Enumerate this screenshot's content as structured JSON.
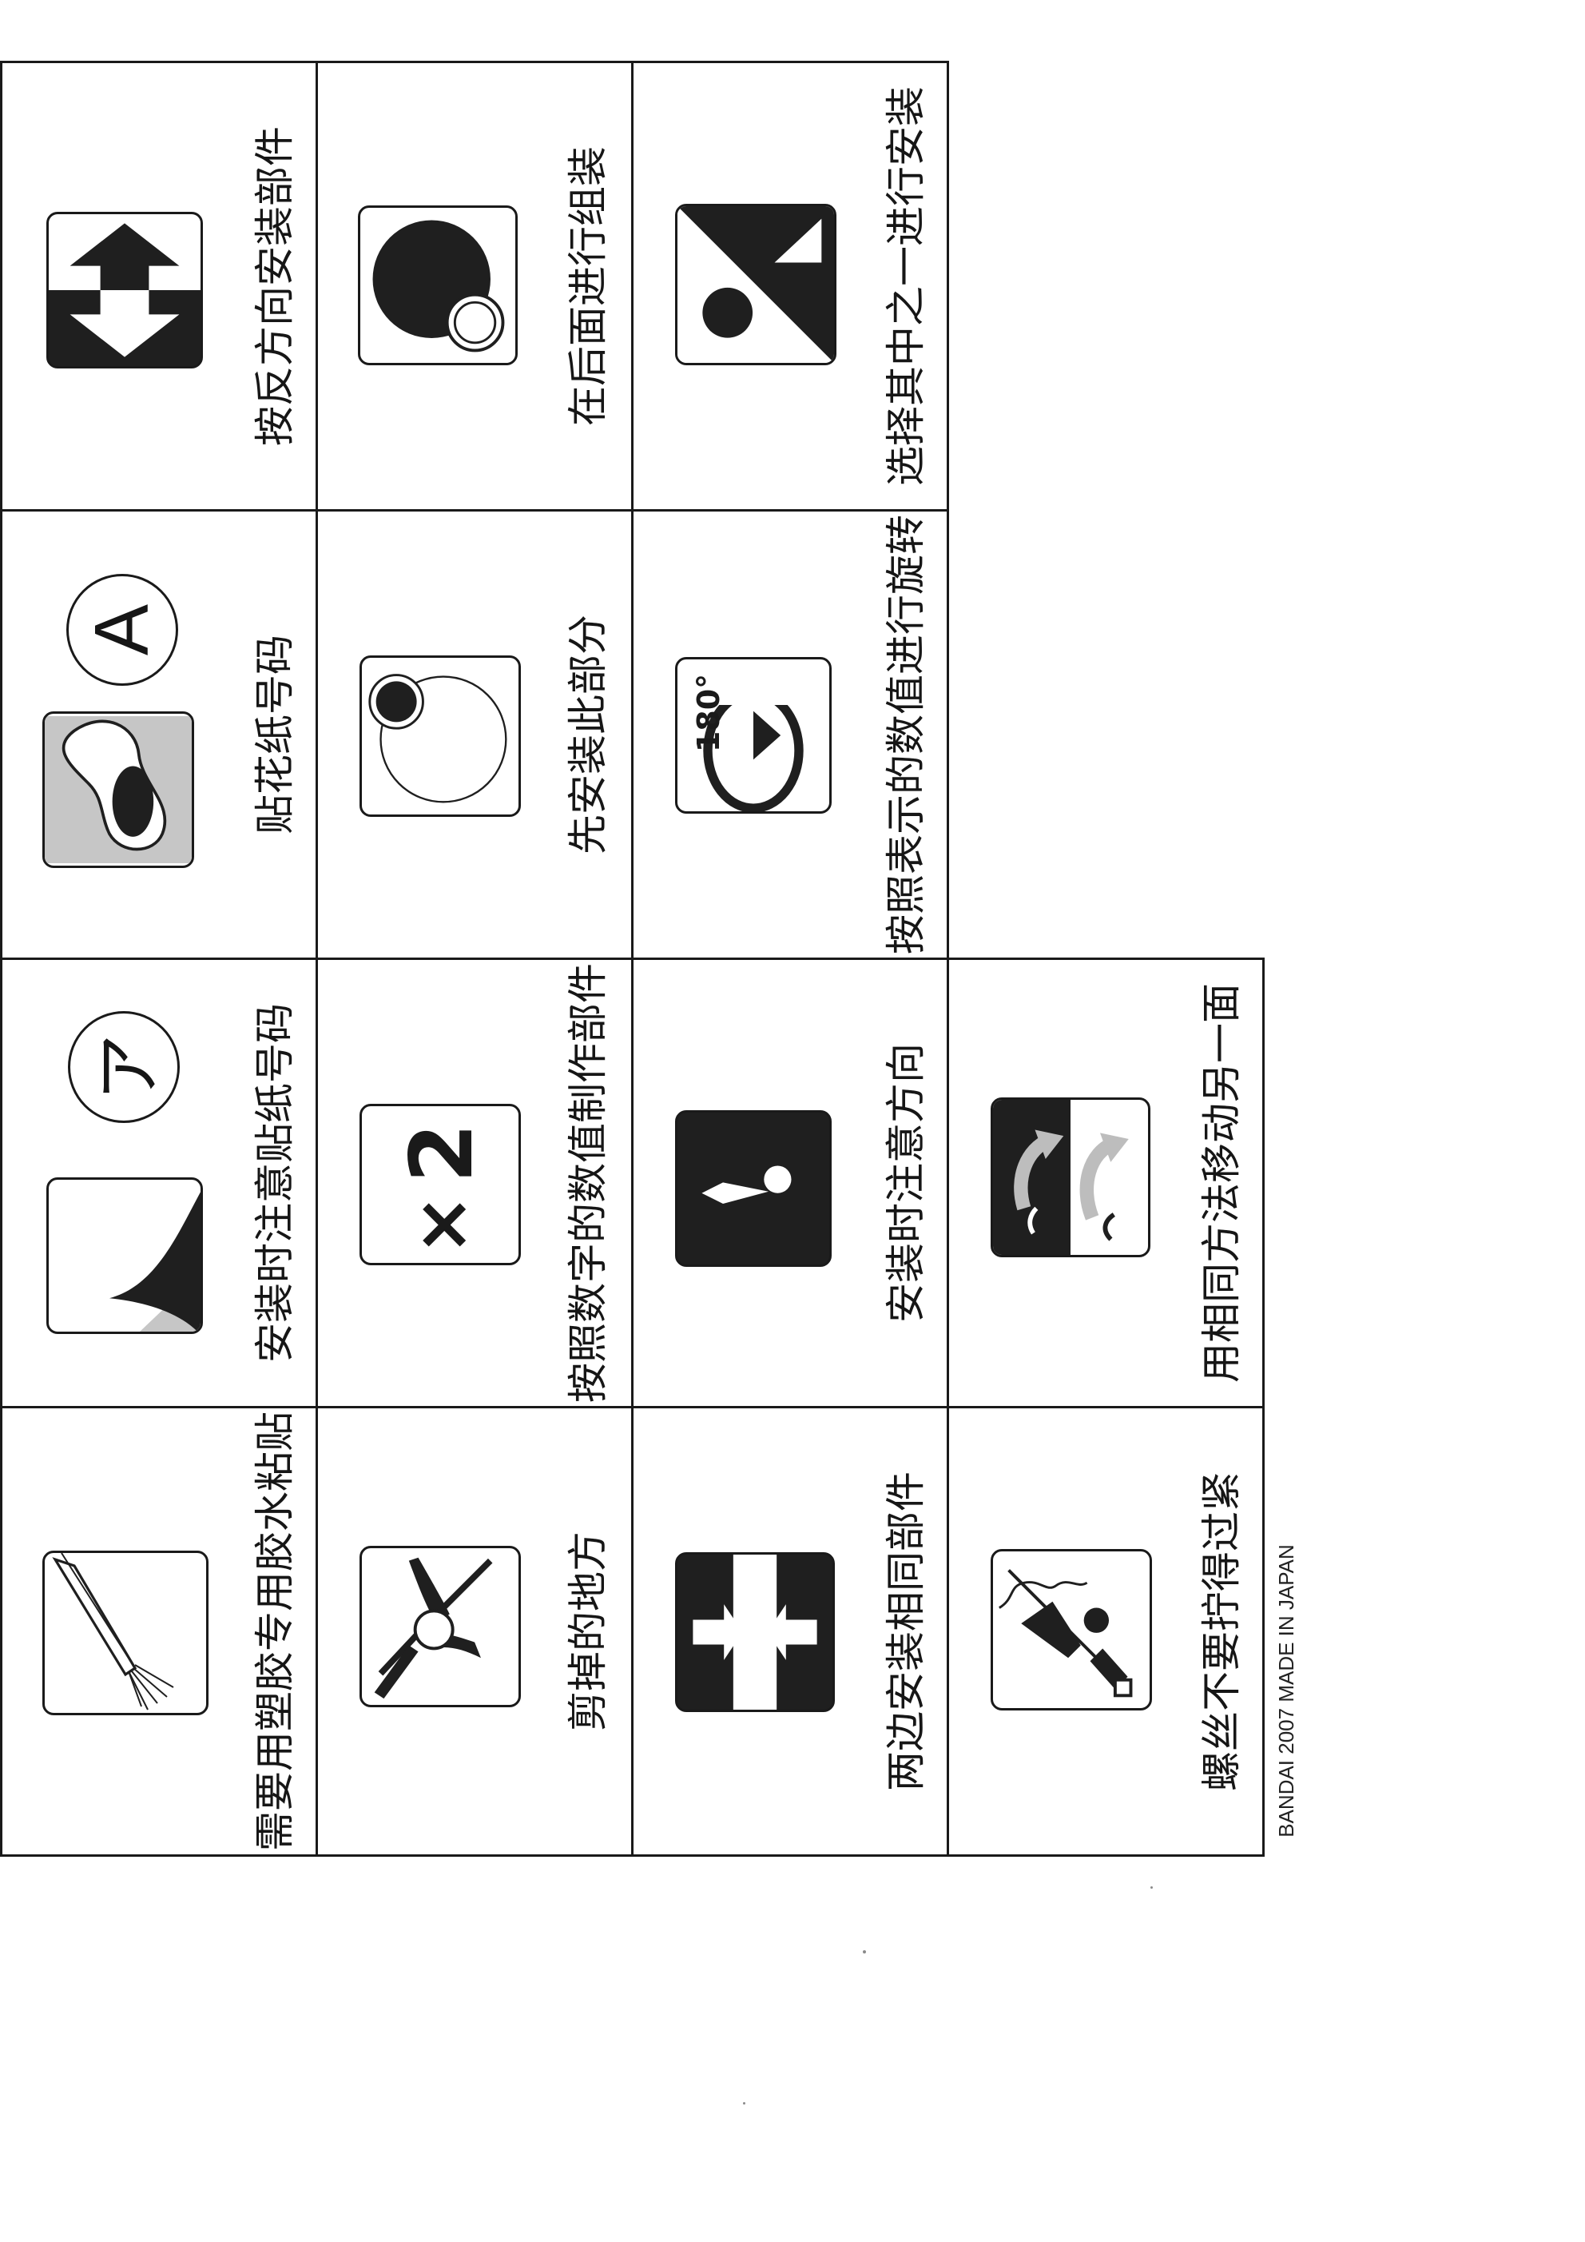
{
  "symbols": [
    {
      "label": "按反方向安装部件",
      "icon": "reverse-direction-arrows-icon"
    },
    {
      "label": "在后面进行组装",
      "icon": "assemble-behind-icon"
    },
    {
      "label": "选择其中之一进行安装",
      "icon": "choose-one-icon"
    },
    {
      "label": "贴花纸号码",
      "icon": "decal-number-icon"
    },
    {
      "label": "先安装此部分",
      "icon": "install-this-first-icon"
    },
    {
      "label": "按照表示的数值进行旋转",
      "icon": "rotate-180-icon"
    },
    {
      "label": "安装时注意贴纸号码",
      "icon": "sticker-number-icon"
    },
    {
      "label": "按照数字的数值制作部件",
      "icon": "make-x2-icon"
    },
    {
      "label": "安装时注意方向",
      "icon": "attention-direction-icon"
    },
    {
      "label": "需要用塑胶专用胶水粘贴",
      "icon": "plastic-cement-brush-icon"
    },
    {
      "label": "剪掉的地方",
      "icon": "nipper-cut-icon"
    },
    {
      "label": "两边安装相同部件",
      "icon": "same-part-both-sides-icon"
    },
    {
      "label": "用相同方法移动另一面",
      "icon": "move-other-side-icon"
    },
    {
      "label": "螺丝不要拧得过紧",
      "icon": "screw-not-too-tight-icon"
    }
  ],
  "icon_text": {
    "decal_letter": "A",
    "sticker_glyph": "ア",
    "rotate_degrees": "180°",
    "multiply_x": "×",
    "multiply_2": "2"
  },
  "footer": "BANDAI 2007 MADE IN JAPAN"
}
